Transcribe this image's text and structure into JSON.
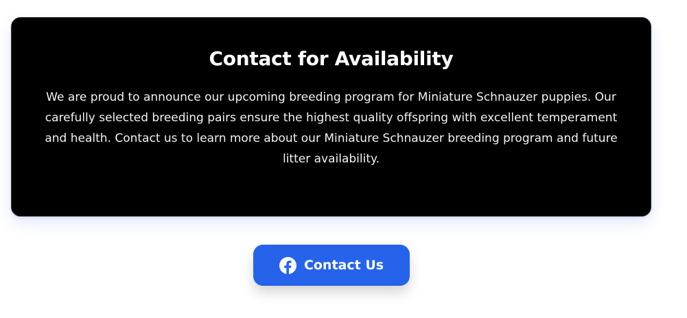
{
  "colors": {
    "page_background": "#ffffff",
    "card_background": "#000000",
    "card_text": "#ffffff",
    "button_background": "#2563eb",
    "button_text": "#ffffff"
  },
  "availability_card": {
    "title": "Contact for Availability",
    "body": "We are proud to announce our upcoming breeding program for Miniature Schnauzer puppies. Our carefully selected breeding pairs ensure the highest quality offspring with excellent temperament and health. Contact us to learn more about our Miniature Schnauzer breeding program and future litter availability."
  },
  "contact_button": {
    "icon": "facebook-icon",
    "label": "Contact Us"
  }
}
